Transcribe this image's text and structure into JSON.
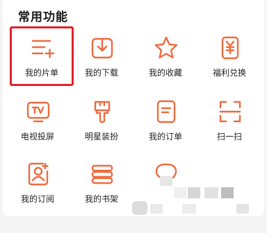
{
  "section_title": "常用功能",
  "accent_color": "#ee6b3f",
  "selected_color": "#e0222a",
  "items": [
    {
      "label": "我的片单",
      "icon": "playlist-add-icon",
      "selected": true
    },
    {
      "label": "我的下载",
      "icon": "download-icon"
    },
    {
      "label": "我的收藏",
      "icon": "star-icon"
    },
    {
      "label": "福利兑换",
      "icon": "yuan-coupon-icon"
    },
    {
      "label": "电视投屏",
      "icon": "tv-cast-icon"
    },
    {
      "label": "明星装扮",
      "icon": "paint-brush-icon"
    },
    {
      "label": "我的订单",
      "icon": "order-doc-icon"
    },
    {
      "label": "扫一扫",
      "icon": "scan-icon"
    },
    {
      "label": "我的订阅",
      "icon": "subscribe-user-icon"
    },
    {
      "label": "我的书架",
      "icon": "bookshelf-icon"
    },
    {
      "label": "",
      "icon": "chat-bubble-icon"
    }
  ]
}
